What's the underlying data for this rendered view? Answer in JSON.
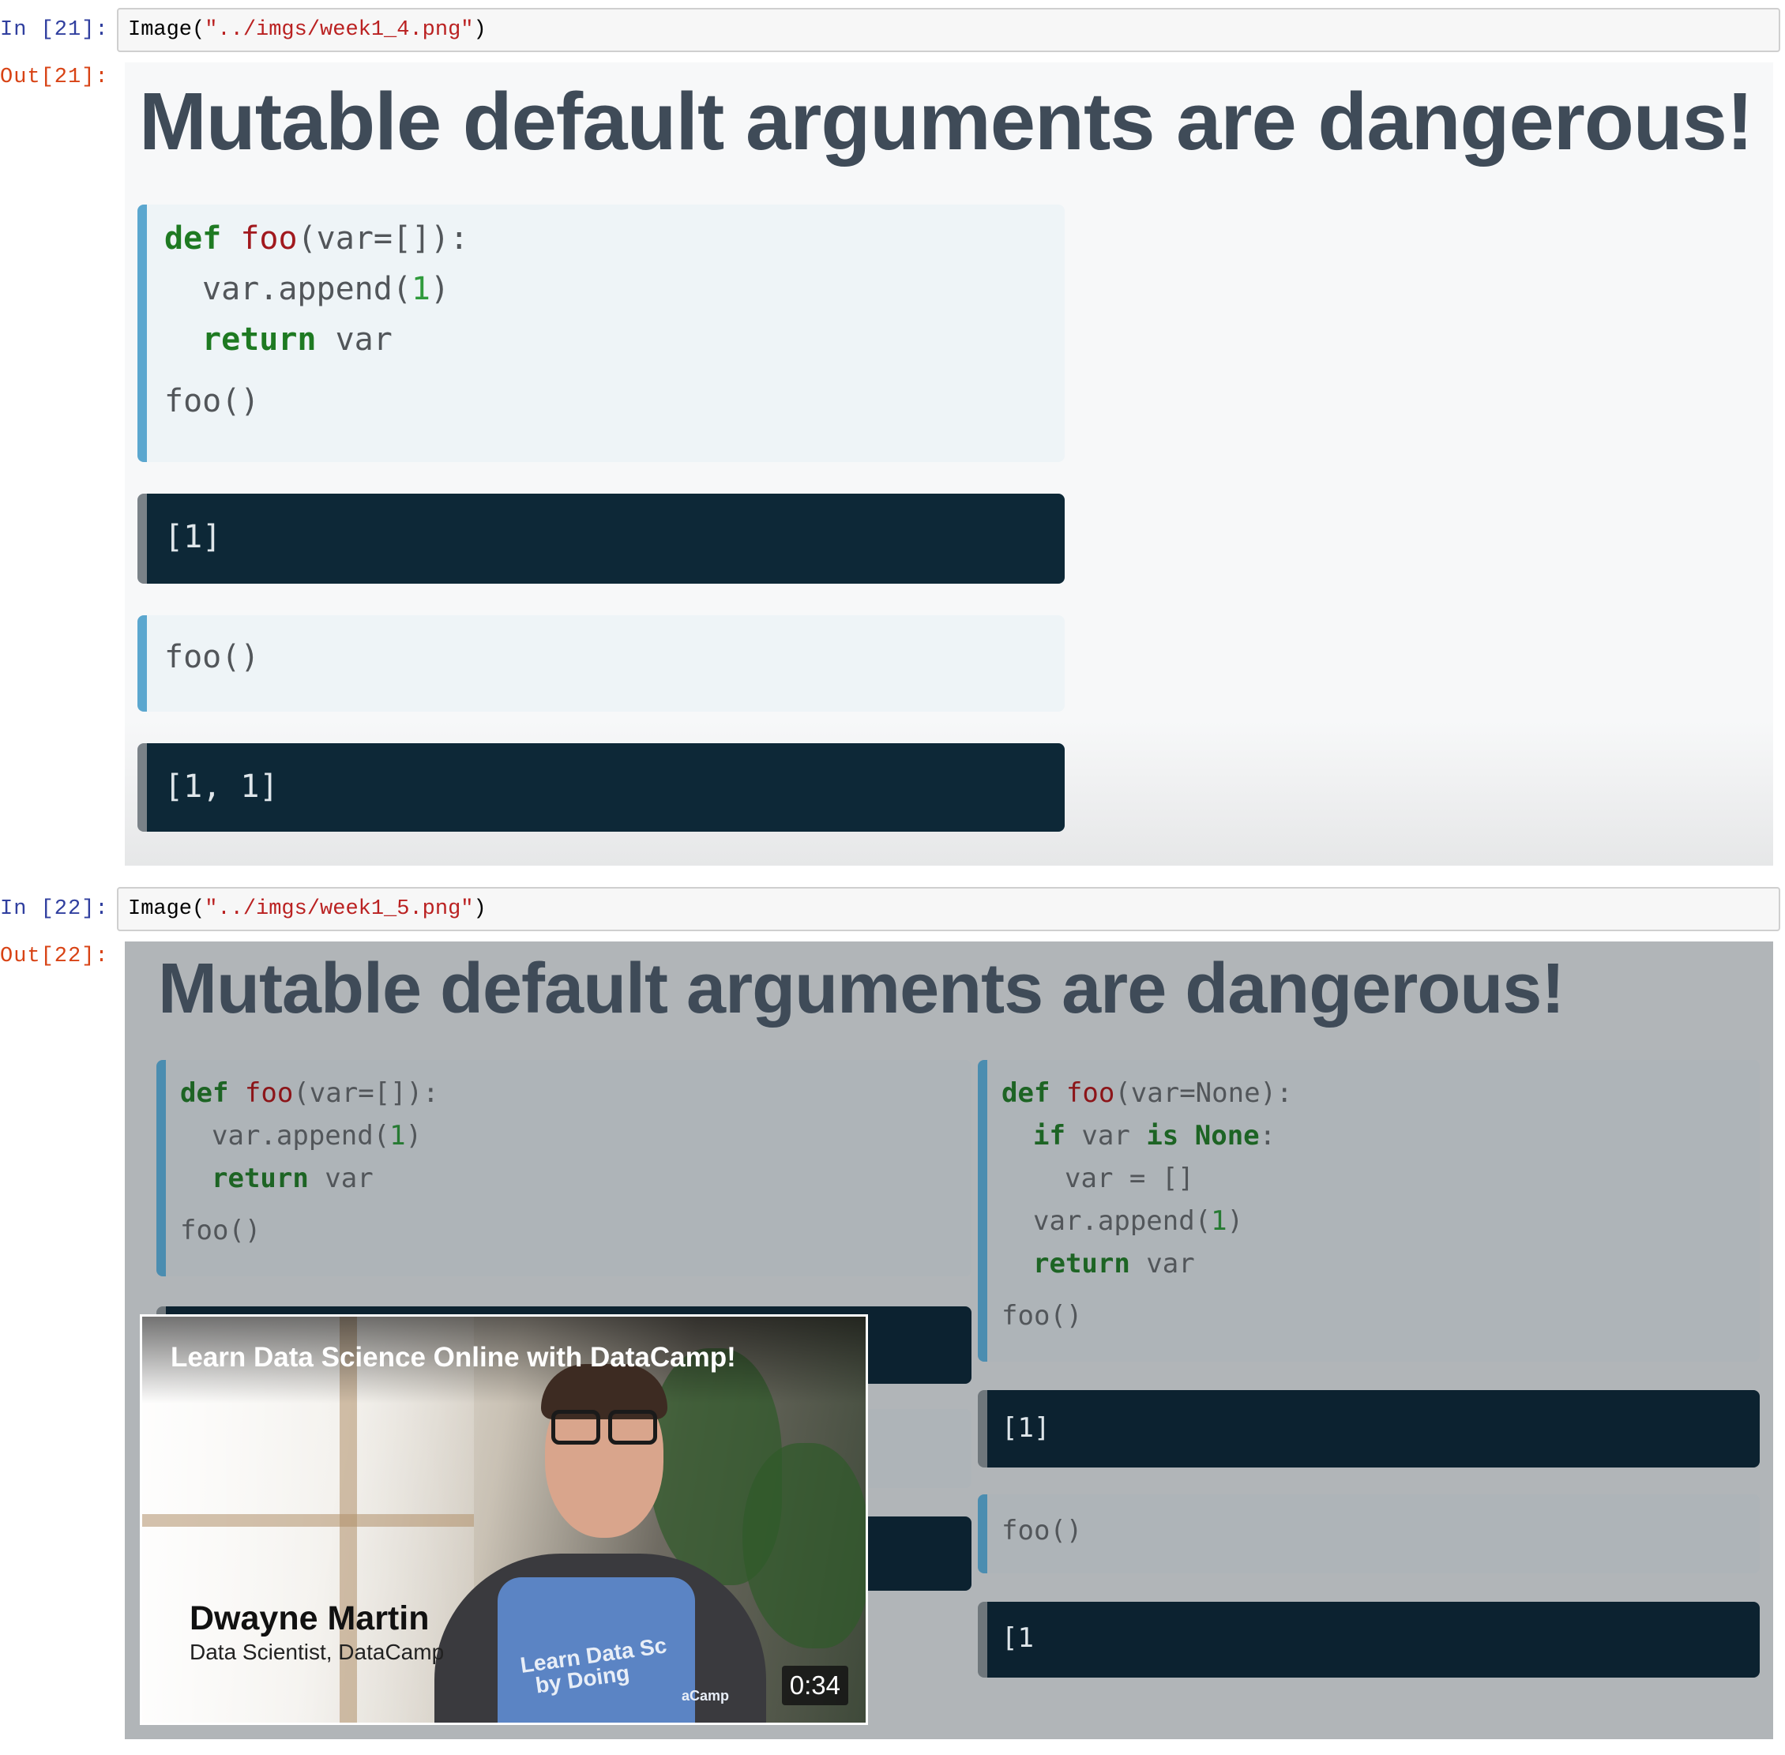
{
  "cells": [
    {
      "in_prompt": "In [21]:",
      "code_prefix": "Image(",
      "code_string": "\"../imgs/week1_4.png\"",
      "code_suffix": ")",
      "out_prompt": "Out[21]:"
    },
    {
      "in_prompt": "In [22]:",
      "code_prefix": "Image(",
      "code_string": "\"../imgs/week1_5.png\"",
      "code_suffix": ")",
      "out_prompt": "Out[22]:"
    }
  ],
  "slide1": {
    "title": "Mutable default arguments are dangerous!",
    "code_block_1": {
      "line1_def": "def",
      "line1_fn": "foo",
      "line1_rest": "(var=[]):",
      "line2_pre": "var.append(",
      "line2_num": "1",
      "line2_post": ")",
      "line3_kw": "return",
      "line3_rest": " var",
      "line4": "foo()"
    },
    "output_1": "[1]",
    "code_block_2": "foo()",
    "output_2": "[1, 1]"
  },
  "slide2": {
    "title": "Mutable default arguments are dangerous!",
    "left": {
      "line1_def": "def",
      "line1_fn": "foo",
      "line1_rest": "(var=[]):",
      "line2_pre": "var.append(",
      "line2_num": "1",
      "line2_post": ")",
      "line3_kw": "return",
      "line3_rest": " var",
      "line4": "foo()"
    },
    "right": {
      "line1_def": "def",
      "line1_fn": "foo",
      "line1_rest": "(var=None):",
      "line2_if": "if",
      "line2_mid": " var ",
      "line2_is": "is",
      "line2_sp": " ",
      "line2_none": "None",
      "line2_colon": ":",
      "line3": "var = []",
      "line4_pre": "var.append(",
      "line4_num": "1",
      "line4_post": ")",
      "line5_kw": "return",
      "line5_rest": " var",
      "line6": "foo()",
      "output_1": "[1]",
      "code_2": "foo()",
      "output_2": "[1"
    }
  },
  "video": {
    "title": "Learn Data Science Online with DataCamp!",
    "presenter_name": "Dwayne Martin",
    "presenter_role": "Data Scientist, DataCamp",
    "shirt_text": "Learn Data Sc\n  by Doing",
    "shirt_logo": "aCamp",
    "duration": "0:34"
  },
  "colors": {
    "in_prompt": "#303F9F",
    "out_prompt": "#D84315",
    "string_literal": "#BA2121",
    "keyword": "#1e7a22",
    "function_name": "#a1191e",
    "number": "#2f9a3c",
    "code_dark_bg": "#0d2837",
    "code_light_bg": "#eef4f7",
    "accent_bar": "#5ba7cf"
  }
}
